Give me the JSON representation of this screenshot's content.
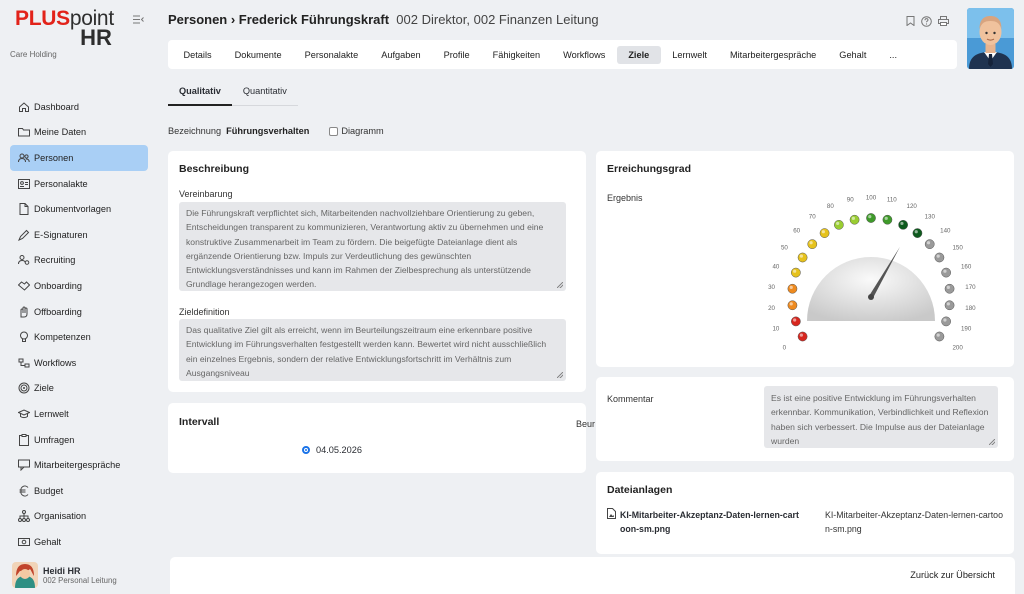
{
  "brand": {
    "plus": "PLUS",
    "point": "point",
    "hr": "HR",
    "company": "Care Holding"
  },
  "sidebar": {
    "items": [
      {
        "label": "Dashboard",
        "icon": "home-icon"
      },
      {
        "label": "Meine Daten",
        "icon": "folder-icon"
      },
      {
        "label": "Personen",
        "icon": "people-icon",
        "active": true
      },
      {
        "label": "Personalakte",
        "icon": "id-card-icon"
      },
      {
        "label": "Dokumentvorlagen",
        "icon": "document-icon"
      },
      {
        "label": "E-Signaturen",
        "icon": "pen-icon"
      },
      {
        "label": "Recruiting",
        "icon": "recruiting-icon"
      },
      {
        "label": "Onboarding",
        "icon": "handshake-icon"
      },
      {
        "label": "Offboarding",
        "icon": "hand-icon"
      },
      {
        "label": "Kompetenzen",
        "icon": "lightbulb-icon"
      },
      {
        "label": "Workflows",
        "icon": "workflow-icon"
      },
      {
        "label": "Ziele",
        "icon": "target-icon"
      },
      {
        "label": "Lernwelt",
        "icon": "graduation-cap-icon"
      },
      {
        "label": "Umfragen",
        "icon": "clipboard-icon"
      },
      {
        "label": "Mitarbeitergespräche",
        "icon": "chat-icon"
      },
      {
        "label": "Budget",
        "icon": "euro-icon"
      },
      {
        "label": "Organisation",
        "icon": "org-chart-icon"
      },
      {
        "label": "Gehalt",
        "icon": "money-icon"
      }
    ]
  },
  "user": {
    "name": "Heidi HR",
    "role": "002 Personal Leitung"
  },
  "header": {
    "title": "Personen › Frederick Führungskraft",
    "subtitle": "002 Direktor, 002 Finanzen Leitung"
  },
  "tabs": [
    {
      "label": "Details"
    },
    {
      "label": "Dokumente"
    },
    {
      "label": "Personalakte"
    },
    {
      "label": "Aufgaben"
    },
    {
      "label": "Profile"
    },
    {
      "label": "Fähigkeiten"
    },
    {
      "label": "Workflows"
    },
    {
      "label": "Ziele",
      "active": true
    },
    {
      "label": "Lernwelt"
    },
    {
      "label": "Mitarbeitergespräche"
    },
    {
      "label": "Gehalt"
    },
    {
      "label": "..."
    }
  ],
  "subtabs": [
    {
      "label": "Qualitativ",
      "active": true
    },
    {
      "label": "Quantitativ"
    }
  ],
  "bezeichnung": {
    "label": "Bezeichnung",
    "value": "Führungsverhalten",
    "diagramm": "Diagramm"
  },
  "beschreibung": {
    "title": "Beschreibung",
    "vereinbarung_label": "Vereinbarung",
    "vereinbarung": "Die Führungskraft verpflichtet sich, Mitarbeitenden nachvollziehbare Orientierung zu geben, Entscheidungen transparent zu kommunizieren, Verantwortung aktiv zu übernehmen und eine konstruktive Zusammenarbeit im Team zu fördern. Die beigefügte Dateianlage dient als ergänzende Orientierung bzw. Impuls zur Verdeutlichung des gewünschten Entwicklungsverständnisses und kann im Rahmen der Zielbesprechung als unterstützende Grundlage herangezogen werden.",
    "zieldefinition_label": "Zieldefinition",
    "zieldefinition": "Das qualitative Ziel gilt als erreicht, wenn im Beurteilungszeitraum eine erkennbare positive Entwicklung im Führungsverhalten festgestellt werden kann. Bewertet wird nicht ausschließlich ein einzelnes Ergebnis, sondern der relative Entwicklungsfortschritt im Verhältnis zum Ausgangsniveau"
  },
  "intervall": {
    "title": "Intervall",
    "date": "04.05.2026",
    "cut_label": "Beur"
  },
  "erreichung": {
    "title": "Erreichungsgrad",
    "ergebnis_label": "Ergebnis"
  },
  "gauge": {
    "ticks": [
      "0",
      "10",
      "20",
      "30",
      "40",
      "50",
      "60",
      "70",
      "80",
      "90",
      "100",
      "110",
      "120",
      "130",
      "140",
      "150",
      "160",
      "170",
      "180",
      "190",
      "200"
    ],
    "value": 125,
    "max": 200,
    "colors": {
      "red": "#d7261e",
      "orange": "#ee8a1f",
      "yellow": "#e6c21c",
      "lightgreen": "#9acd32",
      "green": "#3f9a2a",
      "darkgreen": "#0e5a1e",
      "gray": "#9a9a9a"
    }
  },
  "kommentar": {
    "label": "Kommentar",
    "text": "Es ist eine positive Entwicklung im Führungsverhalten erkennbar. Kommunikation, Verbindlichkeit und Reflexion haben sich verbessert. Die Impulse aus der Dateianlage wurden"
  },
  "dateianlagen": {
    "title": "Dateianlagen",
    "file": "KI-Mitarbeiter-Akzeptanz-Daten-lernen-cartoon-sm.png"
  },
  "footer": {
    "back": "Zurück zur Übersicht"
  }
}
